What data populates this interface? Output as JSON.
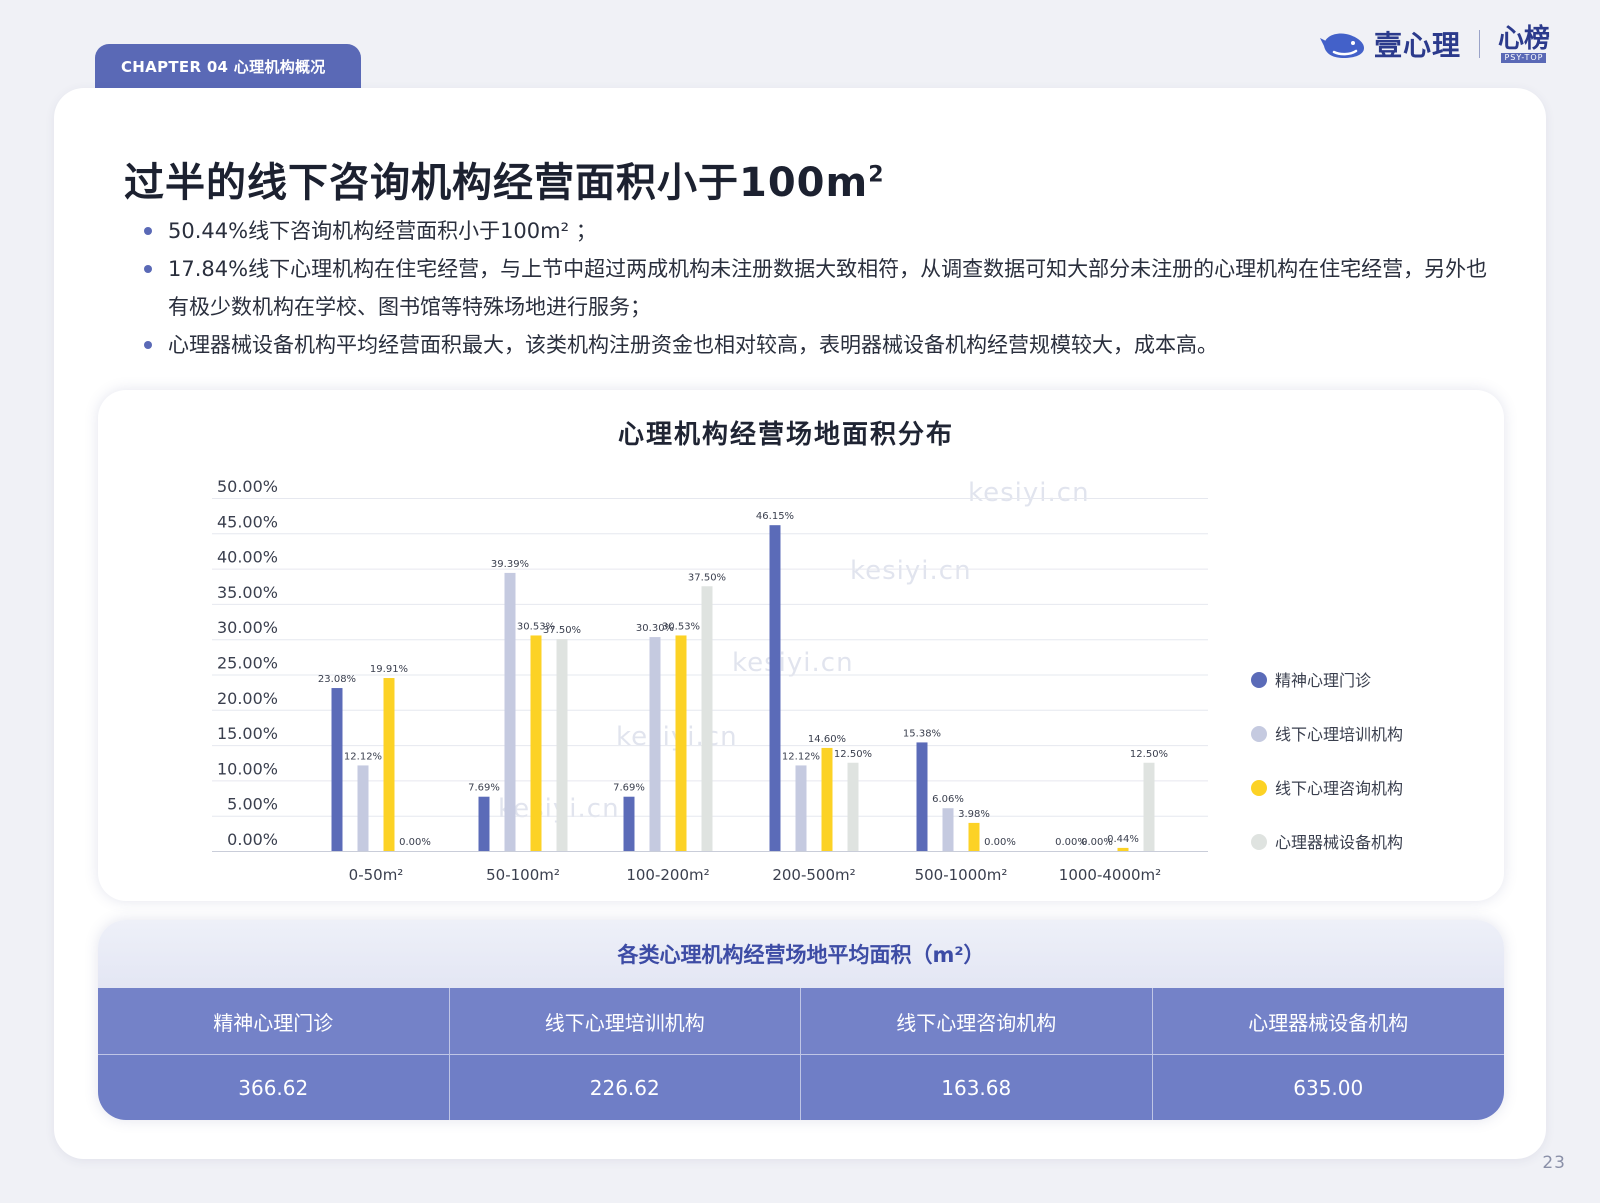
{
  "chapter": {
    "label": "CHAPTER 04  心理机构概况"
  },
  "brand": {
    "name": "壹心理",
    "sub_name": "心榜",
    "sub_tag": "PSY-TOP"
  },
  "title": {
    "text": "过半的线下咨询机构经营面积小于100m",
    "sup": "2"
  },
  "bullets": [
    "50.44%线下咨询机构经营面积小于100m²  ；",
    "17.84%线下心理机构在住宅经营，与上节中超过两成机构未注册数据大致相符，从调查数据可知大部分未注册的心理机构在住宅经营，另外也有极少数机构在学校、图书馆等特殊场地进行服务；",
    "心理器械设备机构平均经营面积最大，该类机构注册资金也相对较高，表明器械设备机构经营规模较大，成本高。"
  ],
  "watermark": "kesiyi.cn",
  "chart_data": {
    "type": "bar",
    "title": "心理机构经营场地面积分布",
    "categories": [
      "0-50m²",
      "50-100m²",
      "100-200m²",
      "200-500m²",
      "500-1000m²",
      "1000-4000m²"
    ],
    "series": [
      {
        "name": "精神心理门诊",
        "values": [
          23.08,
          7.69,
          7.69,
          46.15,
          15.38,
          0.0
        ],
        "labels": [
          "23.08%",
          "7.69%",
          "7.69%",
          "46.15%",
          "15.38%",
          "0.00%"
        ]
      },
      {
        "name": "线下心理培训机构",
        "values": [
          12.12,
          39.39,
          30.3,
          12.12,
          6.06,
          0.0
        ],
        "labels": [
          "12.12%",
          "39.39%",
          "30.30%",
          "12.12%",
          "6.06%",
          "0.00%"
        ]
      },
      {
        "name": "线下心理咨询机构",
        "values": [
          24.5,
          30.53,
          30.53,
          14.6,
          3.98,
          0.44
        ],
        "labels": [
          "19.91%",
          "30.53%",
          "30.53%",
          "14.60%",
          "3.98%",
          "0.44%"
        ]
      },
      {
        "name": "心理器械设备机构",
        "values": [
          0.0,
          30.0,
          37.5,
          12.5,
          0.0,
          12.5
        ],
        "labels": [
          "0.00%",
          "37.50%",
          "37.50%",
          "12.50%",
          "0.00%",
          "12.50%"
        ]
      }
    ],
    "colors": [
      "#5b6bb8",
      "#c5cae0",
      "#fcd225",
      "#dfe3e0"
    ],
    "yticks": [
      "0.00%",
      "5.00%",
      "10.00%",
      "15.00%",
      "20.00%",
      "25.00%",
      "30.00%",
      "35.00%",
      "40.00%",
      "45.00%",
      "50.00%"
    ],
    "ylim": [
      0,
      50
    ],
    "grid": true,
    "legend": "right"
  },
  "table": {
    "title": "各类心理机构经营场地平均面积（m²）",
    "headers": [
      "精神心理门诊",
      "线下心理培训机构",
      "线下心理咨询机构",
      "心理器械设备机构"
    ],
    "values": [
      "366.62",
      "226.62",
      "163.68",
      "635.00"
    ]
  },
  "page_number": "23"
}
